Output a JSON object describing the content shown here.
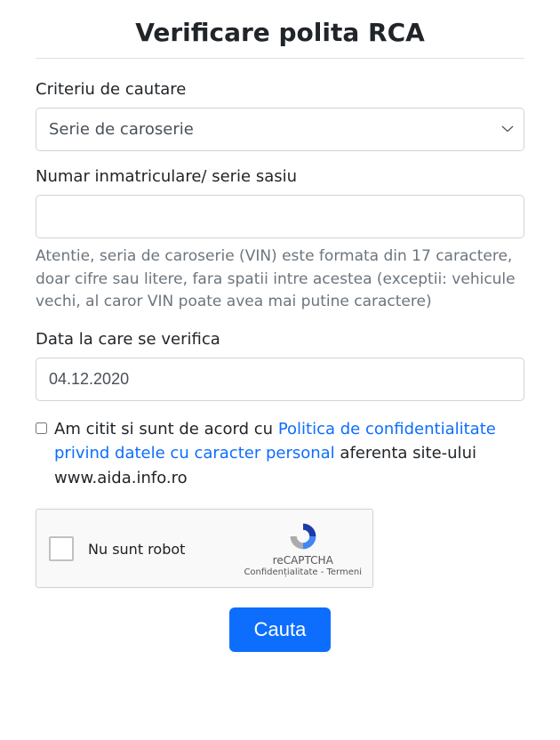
{
  "title": "Verificare polita RCA",
  "criteria": {
    "label": "Criteriu de cautare",
    "selected": "Serie de caroserie"
  },
  "vehicle": {
    "label": "Numar inmatriculare/ serie sasiu",
    "value": "",
    "help": "Atentie, seria de caroserie (VIN) este formata din 17 caractere, doar cifre sau litere, fara spatii intre acestea (exceptii: vehicule vechi, al caror VIN poate avea mai putine caractere)"
  },
  "date": {
    "label": "Data la care se verifica",
    "value": "04.12.2020"
  },
  "consent": {
    "before": "Am citit si sunt de acord cu ",
    "link": "Politica de confidentialitate privind datele cu caracter personal",
    "after": " aferenta site-ului www.aida.info.ro"
  },
  "recaptcha": {
    "label": "Nu sunt robot",
    "brand": "reCAPTCHA",
    "footer": "Confidențialitate - Termeni"
  },
  "submit": {
    "label": "Cauta"
  }
}
